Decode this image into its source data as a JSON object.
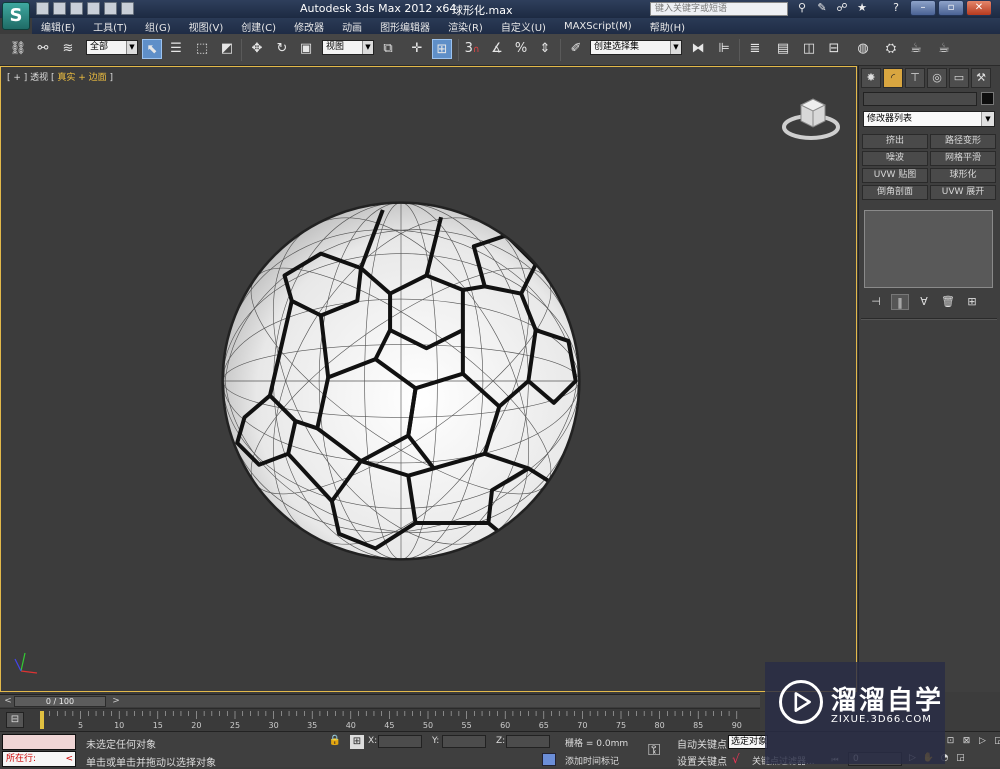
{
  "title_bar": {
    "logo": "3ds-max-logo",
    "app_title": "Autodesk 3ds Max  2012 x64",
    "file_name": "球形化.max",
    "search_placeholder": "键入关键字或短语",
    "window_controls": [
      "minimize",
      "restore",
      "close"
    ]
  },
  "menu": {
    "items": [
      "编辑(E)",
      "工具(T)",
      "组(G)",
      "视图(V)",
      "创建(C)",
      "修改器",
      "动画",
      "图形编辑器",
      "渲染(R)",
      "自定义(U)",
      "MAXScript(M)",
      "帮助(H)"
    ]
  },
  "toolbar": {
    "selection_filter": "全部",
    "reference_coord": "视图",
    "named_selection": "创建选择集"
  },
  "viewport": {
    "label_prefix": "[ + ] 透视 [",
    "label_shading": "真实 + 边面",
    "label_suffix": "]",
    "object": "soccer-ball-mesh",
    "border_color": "#e3b94a"
  },
  "command_panel": {
    "active_tab": "modify",
    "object_name": "",
    "object_color": "#0d0d0d",
    "modifier_list": "修改器列表",
    "modifier_buttons": [
      "挤出",
      "路径变形",
      "噪波",
      "网格平滑",
      "UVW 贴图",
      "球形化",
      "倒角剖面",
      "UVW 展开"
    ]
  },
  "timeline": {
    "time_slider": "0 / 100",
    "ticks": [
      "0",
      "5",
      "10",
      "15",
      "20",
      "25",
      "30",
      "35",
      "40",
      "45",
      "50",
      "55",
      "60",
      "65",
      "70",
      "75",
      "80",
      "85",
      "90"
    ]
  },
  "status": {
    "running_label": "所在行:",
    "selection_status": "未选定任何对象",
    "prompt": "单击或单击并拖动以选择对象",
    "x_label": "X:",
    "y_label": "Y:",
    "z_label": "Z:",
    "grid": "栅格 = 0.0mm",
    "add_time_tag": "添加时间标记",
    "auto_key": "自动关键点",
    "set_key": "设置关键点",
    "selected_object": "选定对象",
    "key_filters": "关键点过滤器...",
    "current_frame": "0"
  },
  "watermark": {
    "title": "溜溜自学",
    "url": "ZIXUE.3D66.COM"
  }
}
